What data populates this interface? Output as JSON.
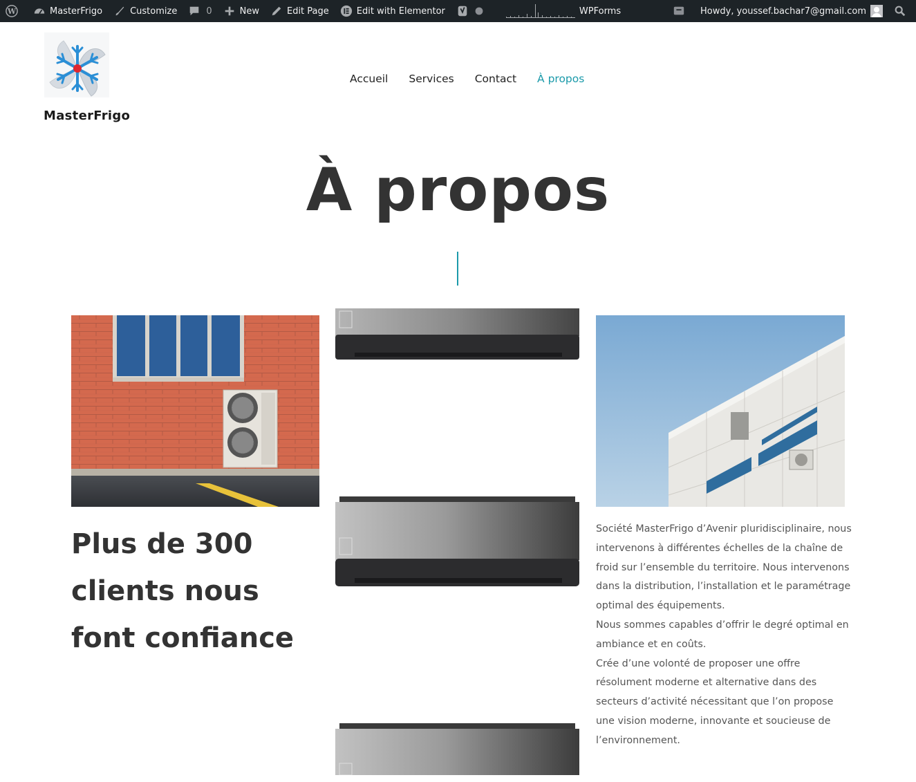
{
  "adminbar": {
    "site_name": "MasterFrigo",
    "customize": "Customize",
    "comments_count": "0",
    "new": "New",
    "edit_page": "Edit Page",
    "edit_elementor": "Edit with Elementor",
    "wpforms": "WPForms",
    "howdy": "Howdy, youssef.bachar7@gmail.com"
  },
  "header": {
    "brand": "MasterFrigo",
    "nav": [
      "Accueil",
      "Services",
      "Contact",
      "À propos"
    ],
    "active_index": 3
  },
  "page": {
    "title": "À propos",
    "headline": "Plus de 300 clients nous font confiance",
    "paragraphs": [
      "Société MasterFrigo d’Avenir pluridisciplinaire, nous intervenons à différentes échelles de la chaîne de froid sur l’ensemble du territoire. Nous intervenons dans la distribution, l’installation et le paramétrage optimal des équipements.",
      "Nous sommes capables d’offrir le degré optimal en ambiance et en coûts.",
      "Crée d’une volonté de proposer une offre résolument moderne et alternative dans des secteurs d’activité nécessitant que l’on propose une vision moderne, innovante et soucieuse de l’environnement."
    ]
  },
  "colors": {
    "accent": "#1b9aaa",
    "adminbar_bg": "#1d2327",
    "heading": "#333333"
  },
  "icons": [
    "wordpress-icon",
    "dashboard-icon",
    "brush-icon",
    "comment-icon",
    "plus-icon",
    "pencil-icon",
    "elementor-icon",
    "yoast-icon",
    "status-dot-icon",
    "notification-icon",
    "search-icon"
  ]
}
